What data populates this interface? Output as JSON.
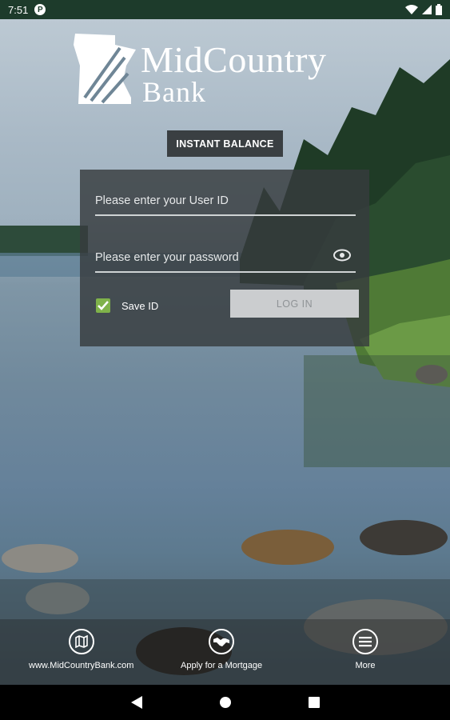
{
  "status_bar": {
    "time": "7:51",
    "app_indicator": "P"
  },
  "logo": {
    "line1": "MidCountry",
    "line2": "Bank"
  },
  "instant_balance": {
    "label": "INSTANT BALANCE"
  },
  "login": {
    "user_id_placeholder": "Please enter your User ID",
    "password_placeholder": "Please enter your password",
    "save_id_label": "Save ID",
    "save_id_checked": true,
    "login_label": "LOG IN"
  },
  "bottom_actions": [
    {
      "label": "www.MidCountryBank.com",
      "icon": "map-icon"
    },
    {
      "label": "Apply for a Mortgage",
      "icon": "handshake-icon"
    },
    {
      "label": "More",
      "icon": "menu-icon"
    }
  ],
  "colors": {
    "status_bar": "#1d3b2b",
    "checkbox": "#7fb24a",
    "panel": "#373c3e"
  }
}
